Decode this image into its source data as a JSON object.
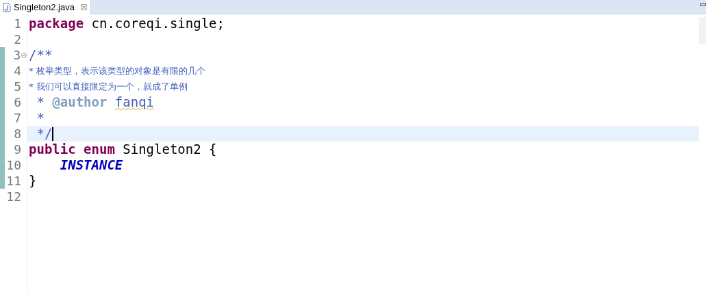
{
  "tab": {
    "title": "Singleton2.java",
    "close": "☒",
    "selected": true
  },
  "lines": [
    {
      "number": "1",
      "changed": false,
      "current": false,
      "foldable": false,
      "tokens": [
        {
          "text": "package ",
          "kind": "keyword"
        },
        {
          "text": "cn.coreqi.single;",
          "kind": "plain"
        }
      ]
    },
    {
      "number": "2",
      "changed": false,
      "current": false,
      "foldable": false
    },
    {
      "number": "3",
      "changed": true,
      "current": false,
      "foldable": true,
      "tokens": [
        {
          "text": "/**",
          "kind": "doc"
        }
      ]
    },
    {
      "number": "4",
      "changed": true,
      "current": false,
      "foldable": false,
      "tokens": [
        {
          "text": "* 枚举类型，表示该类型的对象是有限的几个",
          "kind": "doc_cjk"
        }
      ]
    },
    {
      "number": "5",
      "changed": true,
      "current": false,
      "foldable": false,
      "tokens": [
        {
          "text": "* 我们可以直接限定为一个，就成了单例",
          "kind": "doc_cjk"
        }
      ]
    },
    {
      "number": "6",
      "changed": true,
      "current": false,
      "foldable": false,
      "tokens": [
        {
          "text": " * ",
          "kind": "doc"
        },
        {
          "text": "@author ",
          "kind": "doc_tag"
        },
        {
          "text": "fanqi",
          "kind": "misspelled"
        }
      ]
    },
    {
      "number": "7",
      "changed": true,
      "current": false,
      "foldable": false,
      "tokens": [
        {
          "text": " *",
          "kind": "doc"
        }
      ]
    },
    {
      "number": "8",
      "changed": true,
      "current": true,
      "foldable": false,
      "tokens": [
        {
          "text": " */",
          "kind": "doc"
        }
      ]
    },
    {
      "number": "9",
      "changed": true,
      "current": false,
      "foldable": false,
      "tokens": [
        {
          "text": "public ",
          "kind": "keyword"
        },
        {
          "text": "enum ",
          "kind": "keyword"
        },
        {
          "text": "Singleton2 {",
          "kind": "plain"
        }
      ]
    },
    {
      "number": "10",
      "changed": true,
      "current": false,
      "foldable": false,
      "tokens": [
        {
          "text": "    INSTANCE",
          "kind": "constant"
        }
      ]
    },
    {
      "number": "11",
      "changed": true,
      "current": false,
      "foldable": false,
      "tokens": [
        {
          "text": "}",
          "kind": "plain"
        }
      ]
    },
    {
      "number": "12",
      "changed": false,
      "current": false,
      "foldable": false
    }
  ]
}
